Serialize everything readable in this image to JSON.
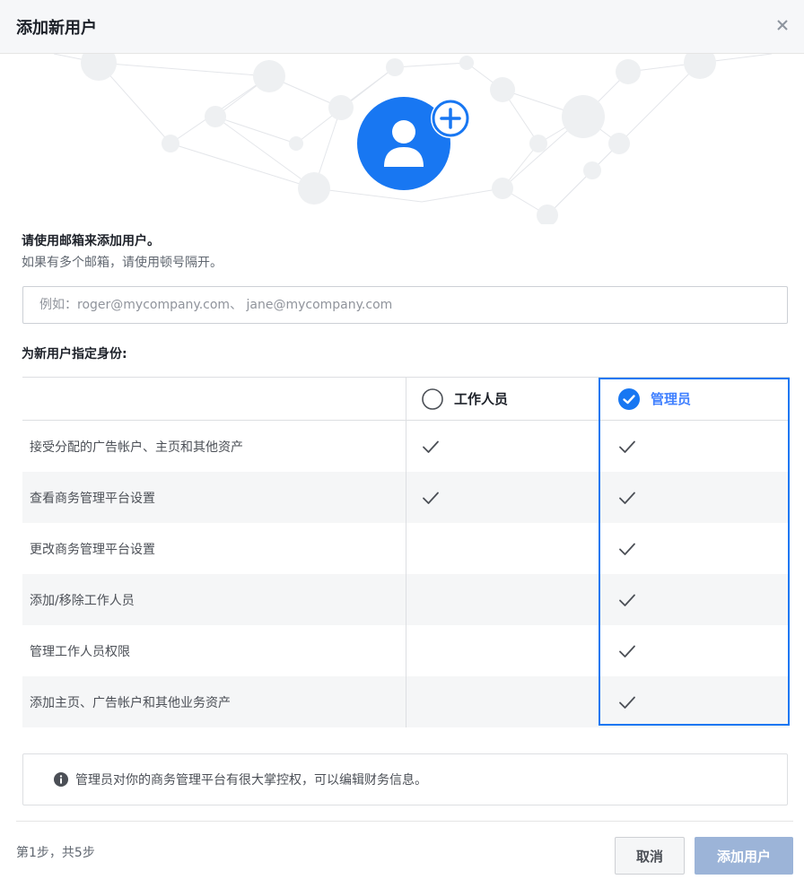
{
  "dialog": {
    "title": "添加新用户",
    "close_icon": "close-icon"
  },
  "hero": {
    "icon": "add-user-icon",
    "accent": "#1877f2"
  },
  "intro": {
    "title": "请使用邮箱来添加用户。",
    "subtitle": "如果有多个邮箱，请使用顿号隔开。"
  },
  "email": {
    "value": "",
    "placeholder": "例如：roger@mycompany.com、 jane@mycompany.com"
  },
  "roles": {
    "title": "为新用户指定身份:",
    "employee_label": "工作人员",
    "employee_selected": false,
    "admin_label": "管理员",
    "admin_selected": true
  },
  "permissions": [
    {
      "label": "接受分配的广告帐户、主页和其他资产",
      "employee": true,
      "admin": true
    },
    {
      "label": "查看商务管理平台设置",
      "employee": true,
      "admin": true
    },
    {
      "label": "更改商务管理平台设置",
      "employee": false,
      "admin": true
    },
    {
      "label": "添加/移除工作人员",
      "employee": false,
      "admin": true
    },
    {
      "label": "管理工作人员权限",
      "employee": false,
      "admin": true
    },
    {
      "label": "添加主页、广告帐户和其他业务资产",
      "employee": false,
      "admin": true
    }
  ],
  "info": {
    "icon": "info-icon",
    "text": "管理员对你的商务管理平台有很大掌控权，可以编辑财务信息。"
  },
  "footer": {
    "step_text": "第1步，共5步",
    "cancel_label": "取消",
    "add_label": "添加用户"
  },
  "colors": {
    "accent": "#1877f2",
    "primary_disabled": "#9cb4d8",
    "border": "#dddfe2"
  }
}
